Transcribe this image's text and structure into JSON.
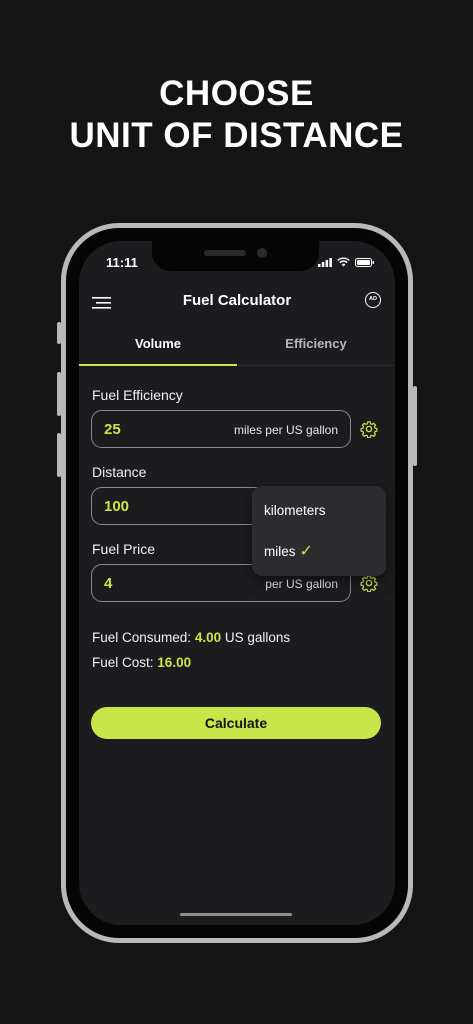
{
  "headline": {
    "line1": "CHOOSE",
    "line2": "UNIT OF DISTANCE"
  },
  "status": {
    "time": "11:11"
  },
  "topbar": {
    "title": "Fuel Calculator",
    "ad_badge": "AD"
  },
  "tabs": [
    {
      "label": "Volume",
      "active": true
    },
    {
      "label": "Efficiency",
      "active": false
    }
  ],
  "form": {
    "efficiency": {
      "label": "Fuel Efficiency",
      "value": "25",
      "unit": "miles per US gallon"
    },
    "distance": {
      "label": "Distance",
      "value": "100"
    },
    "price": {
      "label": "Fuel Price",
      "value": "4",
      "unit": "per US gallon"
    }
  },
  "dropdown": {
    "options": [
      "kilometers",
      "miles"
    ],
    "selected": "miles",
    "check": "✓"
  },
  "results": {
    "consumed_label": "Fuel Consumed:",
    "consumed_value": "4.00",
    "consumed_unit": "US gallons",
    "cost_label": "Fuel Cost:",
    "cost_value": "16.00"
  },
  "actions": {
    "calculate_label": "Calculate"
  },
  "colors": {
    "accent": "#c6e64a",
    "background": "#141414",
    "screen": "#1c1c1e"
  }
}
